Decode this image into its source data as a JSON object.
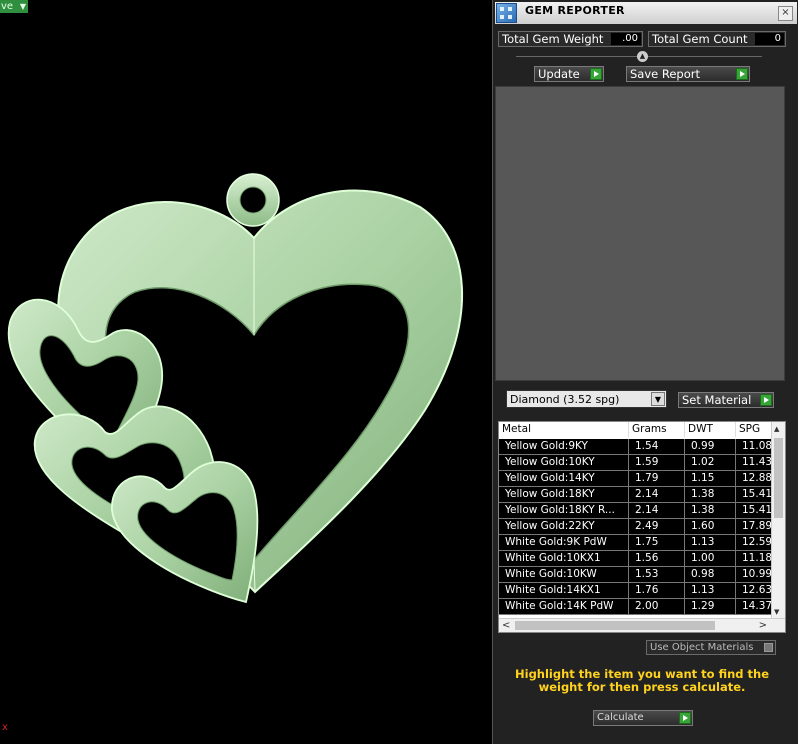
{
  "viewport": {
    "tab_label": "ve",
    "axis_label": "x",
    "model_color": "#b6dbb0"
  },
  "panel": {
    "title": "GEM REPORTER",
    "close_label": "×",
    "total_weight_label": "Total Gem Weight",
    "total_weight_value": ".00",
    "total_count_label": "Total Gem Count",
    "total_count_value": "0",
    "update_label": "Update",
    "save_label": "Save Report",
    "gem_select_value": "Diamond     (3.52 spg)",
    "set_material_label": "Set Material",
    "use_object_materials_label": "Use Object Materials",
    "instruction": "Highlight the item you want to find the weight for then press calculate.",
    "calculate_label": "Calculate",
    "accent_color": "#38a538",
    "instruction_color": "#ffd21e"
  },
  "table": {
    "columns": [
      "Metal",
      "Grams",
      "DWT",
      "SPG"
    ],
    "rows": [
      [
        "Yellow Gold:9KY",
        "1.54",
        "0.99",
        "11.08"
      ],
      [
        "Yellow Gold:10KY",
        "1.59",
        "1.02",
        "11.43"
      ],
      [
        "Yellow Gold:14KY",
        "1.79",
        "1.15",
        "12.88"
      ],
      [
        "Yellow Gold:18KY",
        "2.14",
        "1.38",
        "15.41"
      ],
      [
        "Yellow Gold:18KY R...",
        "2.14",
        "1.38",
        "15.41"
      ],
      [
        "Yellow Gold:22KY",
        "2.49",
        "1.60",
        "17.89"
      ],
      [
        "White Gold:9K PdW",
        "1.75",
        "1.13",
        "12.59"
      ],
      [
        "White Gold:10KX1",
        "1.56",
        "1.00",
        "11.18"
      ],
      [
        "White Gold:10KW",
        "1.53",
        "0.98",
        "10.99"
      ],
      [
        "White Gold:14KX1",
        "1.76",
        "1.13",
        "12.63"
      ],
      [
        "White Gold:14K PdW",
        "2.00",
        "1.29",
        "14.37"
      ]
    ]
  }
}
